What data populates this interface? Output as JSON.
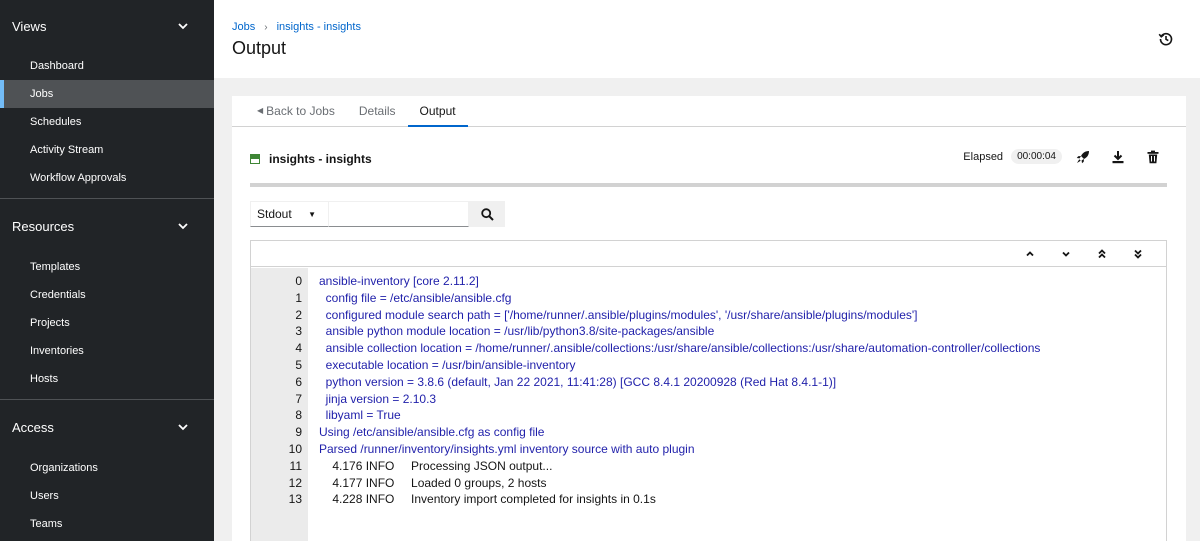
{
  "sidebar": {
    "groups": [
      {
        "title": "Views",
        "items": [
          "Dashboard",
          "Jobs",
          "Schedules",
          "Activity Stream",
          "Workflow Approvals"
        ]
      },
      {
        "title": "Resources",
        "items": [
          "Templates",
          "Credentials",
          "Projects",
          "Inventories",
          "Hosts"
        ]
      },
      {
        "title": "Access",
        "items": [
          "Organizations",
          "Users",
          "Teams"
        ]
      }
    ],
    "active_item": "Jobs"
  },
  "header": {
    "breadcrumb": [
      "Jobs",
      "insights - insights"
    ],
    "title": "Output",
    "history_icon": "history-icon"
  },
  "tabs": {
    "back": "Back to Jobs",
    "details": "Details",
    "output": "Output"
  },
  "job": {
    "name": "insights - insights",
    "status_color": "#3e8635",
    "elapsed_label": "Elapsed",
    "elapsed_value": "00:00:04",
    "actions": [
      "rocket-icon",
      "download-icon",
      "trash-icon"
    ]
  },
  "search": {
    "select_value": "Stdout",
    "placeholder": "",
    "button_icon": "search-icon"
  },
  "output": {
    "toolbar": [
      "scroll-up-icon",
      "scroll-down-icon",
      "scroll-first-icon",
      "scroll-last-icon"
    ],
    "lines": [
      {
        "n": "0",
        "text": "ansible-inventory [core 2.11.2]",
        "color": "blue"
      },
      {
        "n": "1",
        "text": "  config file = /etc/ansible/ansible.cfg",
        "color": "blue"
      },
      {
        "n": "2",
        "text": "  configured module search path = ['/home/runner/.ansible/plugins/modules', '/usr/share/ansible/plugins/modules']",
        "color": "blue"
      },
      {
        "n": "3",
        "text": "  ansible python module location = /usr/lib/python3.8/site-packages/ansible",
        "color": "blue"
      },
      {
        "n": "4",
        "text": "  ansible collection location = /home/runner/.ansible/collections:/usr/share/ansible/collections:/usr/share/automation-controller/collections",
        "color": "blue"
      },
      {
        "n": "5",
        "text": "  executable location = /usr/bin/ansible-inventory",
        "color": "blue"
      },
      {
        "n": "6",
        "text": "  python version = 3.8.6 (default, Jan 22 2021, 11:41:28) [GCC 8.4.1 20200928 (Red Hat 8.4.1-1)]",
        "color": "blue"
      },
      {
        "n": "7",
        "text": "  jinja version = 2.10.3",
        "color": "blue"
      },
      {
        "n": "8",
        "text": "  libyaml = True",
        "color": "blue"
      },
      {
        "n": "9",
        "text": "Using /etc/ansible/ansible.cfg as config file",
        "color": "blue"
      },
      {
        "n": "10",
        "text": "Parsed /runner/inventory/insights.yml inventory source with auto plugin",
        "color": "blue"
      },
      {
        "n": "11",
        "text": "    4.176 INFO     Processing JSON output...",
        "color": "dark"
      },
      {
        "n": "12",
        "text": "    4.177 INFO     Loaded 0 groups, 2 hosts",
        "color": "dark"
      },
      {
        "n": "13",
        "text": "    4.228 INFO     Inventory import completed for insights in 0.1s",
        "color": "dark"
      }
    ]
  }
}
